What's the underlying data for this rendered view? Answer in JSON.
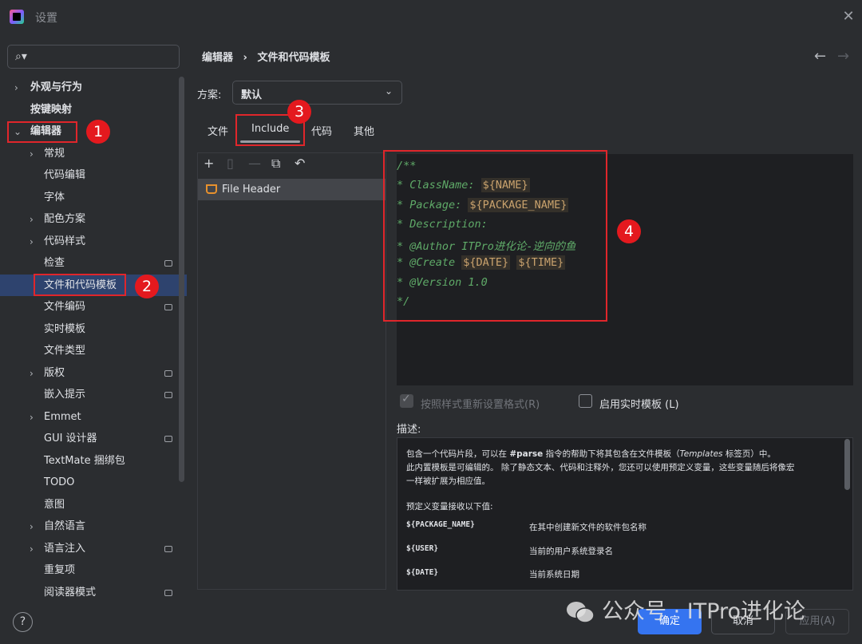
{
  "window": {
    "title": "设置"
  },
  "search": {
    "placeholder": ""
  },
  "sidebar": {
    "items": [
      {
        "label": "外观与行为"
      },
      {
        "label": "按键映射"
      },
      {
        "label": "编辑器"
      },
      {
        "label": "常规"
      },
      {
        "label": "代码编辑"
      },
      {
        "label": "字体"
      },
      {
        "label": "配色方案"
      },
      {
        "label": "代码样式"
      },
      {
        "label": "检查"
      },
      {
        "label": "文件和代码模板"
      },
      {
        "label": "文件编码"
      },
      {
        "label": "实时模板"
      },
      {
        "label": "文件类型"
      },
      {
        "label": "版权"
      },
      {
        "label": "嵌入提示"
      },
      {
        "label": "Emmet"
      },
      {
        "label": "GUI 设计器"
      },
      {
        "label": "TextMate 捆绑包"
      },
      {
        "label": "TODO"
      },
      {
        "label": "意图"
      },
      {
        "label": "自然语言"
      },
      {
        "label": "语言注入"
      },
      {
        "label": "重复项"
      },
      {
        "label": "阅读器模式"
      }
    ]
  },
  "breadcrumb": {
    "parent": "编辑器",
    "separator": "›",
    "current": "文件和代码模板"
  },
  "scheme": {
    "label": "方案:",
    "value": "默认"
  },
  "tabs": [
    {
      "label": "文件"
    },
    {
      "label": "Include"
    },
    {
      "label": "代码"
    },
    {
      "label": "其他"
    }
  ],
  "template_list": {
    "items": [
      {
        "label": "File Header"
      }
    ]
  },
  "editor": {
    "lines": [
      {
        "text": "/**"
      },
      {
        "prefix": "* ClassName: ",
        "var": "${NAME}",
        "suffix": ""
      },
      {
        "prefix": "* Package: ",
        "var": "${PACKAGE_NAME}",
        "suffix": ""
      },
      {
        "text": "* Description:"
      },
      {
        "text": "* @Author ITPro进化论-逆向的鱼"
      },
      {
        "prefix": "* @Create ",
        "var": "${DATE}",
        "var2": "${TIME}"
      },
      {
        "text": "* @Version 1.0"
      },
      {
        "text": "*/"
      }
    ]
  },
  "options": {
    "reformat_label": "按照样式重新设置格式(R)",
    "reformat_checked": true,
    "live_template_label": "启用实时模板 (L)",
    "live_template_checked": false
  },
  "description": {
    "label": "描述:",
    "line1_a": "包含一个代码片段，可以在 ",
    "line1_b": "#parse",
    "line1_c": " 指令的帮助下将其包含在文件模板（",
    "line1_d": "Templates",
    "line1_e": " 标签页）中。",
    "line2": "此内置模板是可编辑的。 除了静态文本、代码和注释外，您还可以使用预定义变量，这些变量随后将像宏",
    "line3": "一样被扩展为相应值。",
    "line4": "预定义变量接收以下值:",
    "vars": [
      {
        "name": "${PACKAGE_NAME}",
        "value": "在其中创建新文件的软件包名称"
      },
      {
        "name": "${USER}",
        "value": "当前的用户系统登录名"
      },
      {
        "name": "${DATE}",
        "value": "当前系统日期"
      }
    ]
  },
  "footer": {
    "help": "?",
    "ok": "确定",
    "cancel": "取消",
    "apply": "应用(A)"
  },
  "annotations": {
    "n1": "1",
    "n2": "2",
    "n3": "3",
    "n4": "4"
  },
  "watermark": {
    "text": "公众号 · ITPro进化论"
  },
  "colors": {
    "accent": "#3574f0",
    "selection": "#2e436e",
    "annotation_red": "#e4191e",
    "comment_green": "#5faa68"
  }
}
